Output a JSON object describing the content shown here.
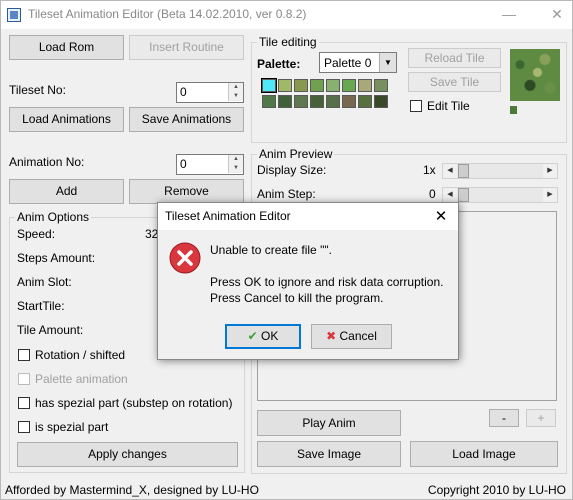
{
  "window": {
    "title": "Tileset Animation Editor (Beta 14.02.2010, ver 0.8.2)",
    "minimize_glyph": "—",
    "close_glyph": "✕"
  },
  "left": {
    "load_rom": "Load Rom",
    "insert_routine": "Insert Routine",
    "tileset_no_label": "Tileset No:",
    "tileset_no_value": "0",
    "load_animations": "Load Animations",
    "save_animations": "Save Animations",
    "animation_no_label": "Animation No:",
    "animation_no_value": "0",
    "add": "Add",
    "remove": "Remove"
  },
  "anim_options": {
    "title": "Anim Options",
    "speed_label": "Speed:",
    "speed_value": "32s",
    "steps_amount": "Steps Amount:",
    "anim_slot": "Anim Slot:",
    "start_tile": "StartTile:",
    "tile_amount": "Tile Amount:",
    "rotation": "Rotation / shifted",
    "palette_animation": "Palette animation",
    "has_spezial": "has spezial part (substep on rotation)",
    "is_spezial": "is spezial part",
    "apply": "Apply changes"
  },
  "tile_editing": {
    "title": "Tile editing",
    "palette_label": "Palette:",
    "palette_selected": "Palette 0",
    "dropdown_glyph": "▼",
    "reload_tile": "Reload Tile",
    "save_tile": "Save Tile",
    "edit_tile": "Edit Tile",
    "swatches": [
      "#4ee8f8",
      "#a0b868",
      "#889850",
      "#70a050",
      "#88b070",
      "#68a850",
      "#a8a878",
      "#789060",
      "#507848",
      "#406038",
      "#607850",
      "#486038",
      "#58704a",
      "#786850",
      "#587040",
      "#384828"
    ]
  },
  "preview": {
    "title": "Anim Preview",
    "display_size_label": "Display Size:",
    "display_size_value": "1x",
    "anim_step_label": "Anim Step:",
    "anim_step_value": "0",
    "minus": "-",
    "plus": "+",
    "play_anim": "Play Anim",
    "save_image": "Save Image",
    "load_image": "Load Image"
  },
  "status": {
    "left": "Afforded by Mastermind_X, designed by LU-HO",
    "right": "Copyright 2010 by LU-HO"
  },
  "dialog": {
    "title": "Tileset Animation Editor",
    "close_glyph": "✕",
    "line1": "Unable to create file \"\".",
    "line2": "Press OK to ignore and risk data corruption.",
    "line3": "Press Cancel to kill the program.",
    "ok": "OK",
    "cancel": "Cancel",
    "error_color": "#d9363e",
    "ok_color": "#3aa13a",
    "cancel_color": "#d9363e"
  }
}
